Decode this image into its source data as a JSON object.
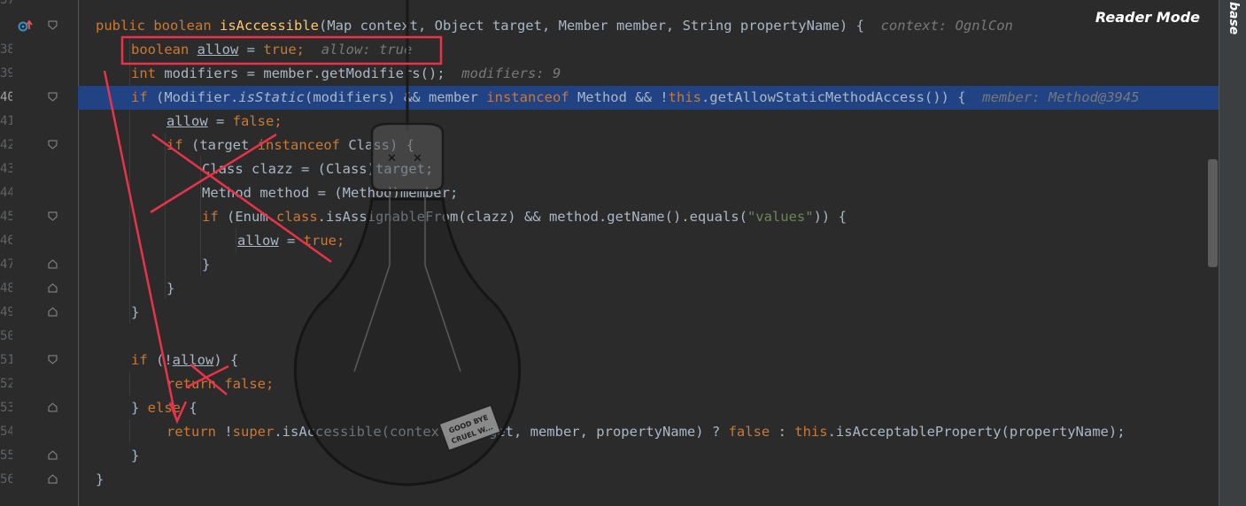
{
  "editor": {
    "reader_mode_label": "Reader Mode",
    "sidebar_label": "base",
    "line_numbers": [
      "37",
      "38",
      "39",
      "40",
      "41",
      "42",
      "43",
      "44",
      "45",
      "46",
      "47",
      "48",
      "49",
      "50",
      "51",
      "52",
      "53",
      "54",
      "55",
      "56"
    ],
    "current_line": "40"
  },
  "code": {
    "l37_kw1": "public",
    "l37_kw2": "boolean",
    "l37_name": "isAccessible",
    "l37_rest": "(Map context, Object target, Member member, String propertyName) {",
    "l37_hint": "context: OgnlCon",
    "l38_kw": "boolean",
    "l38_var": "allow",
    "l38_eq": " = ",
    "l38_val": "true",
    "l38_semi": ";",
    "l38_hint": "allow: true",
    "l39_kw": "int",
    "l39_rest": " modifiers = member.getModifiers();",
    "l39_hint": "modifiers: 9",
    "l40_kw": "if",
    "l40_a": " (Modifier.",
    "l40_static": "isStatic",
    "l40_b": "(modifiers) && member ",
    "l40_inst": "instanceof",
    "l40_c": " Method && !",
    "l40_this": "this",
    "l40_d": ".getAllowStaticMethodAccess()) {",
    "l40_hint": "member: Method@3945",
    "l41_var": "allow",
    "l41_eq": " = ",
    "l41_val": "false",
    "l41_semi": ";",
    "l42_kw": "if",
    "l42_a": " (target ",
    "l42_inst": "instanceof",
    "l42_b": " Class) {",
    "l43": "Class clazz = (Class)target;",
    "l44": "Method method = (Method)member;",
    "l45_kw": "if",
    "l45_a": " (Enum.",
    "l45_cls": "class",
    "l45_b": ".isAssignableFrom(clazz) && method.getName().equals(",
    "l45_str": "\"values\"",
    "l45_c": ")) {",
    "l46_var": "allow",
    "l46_eq": " = ",
    "l46_val": "true",
    "l46_semi": ";",
    "brace_close": "}",
    "l51_kw": "if",
    "l51_a": " (!",
    "l51_var": "allow",
    "l51_b": ") {",
    "l52_kw": "return",
    "l52_val": " false",
    "l52_semi": ";",
    "l53_a": "} ",
    "l53_kw": "else",
    "l53_b": " {",
    "l54_kw": "return",
    "l54_a": " !",
    "l54_super": "super",
    "l54_b": ".isAccessible(context, target, member, propertyName) ? ",
    "l54_false": "false",
    "l54_c": " : ",
    "l54_this": "this",
    "l54_d": ".isAcceptableProperty(propertyName);",
    "l56": "}"
  },
  "sticker": {
    "text1": "GOOD BYE",
    "text2": "CRUEL W..."
  },
  "colors": {
    "keyword": "#cc7832",
    "method_decl": "#ffc66d",
    "string": "#6a8759",
    "hint": "#787878",
    "annotation_red": "#e8334a",
    "highlight_line": "#214283"
  }
}
